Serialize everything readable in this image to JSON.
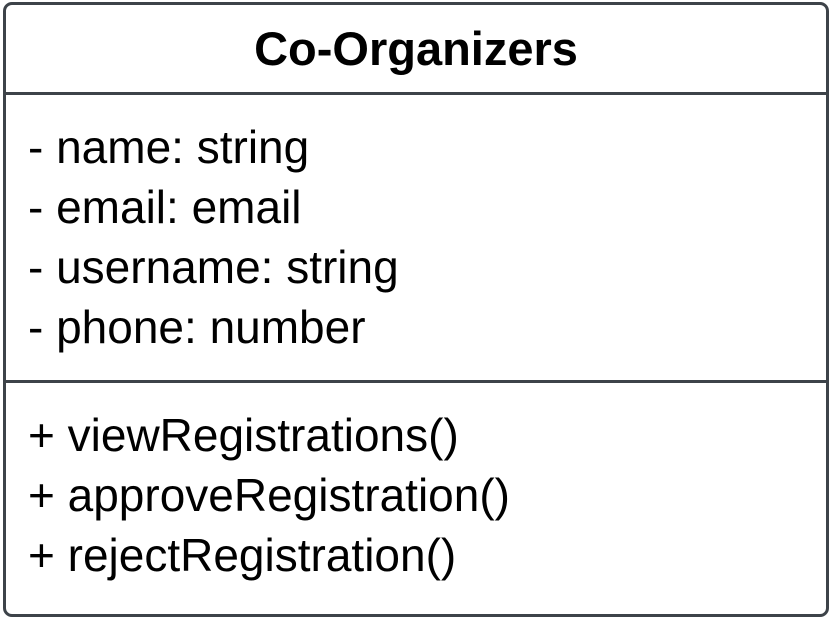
{
  "class": {
    "name": "Co-Organizers",
    "attributes": [
      "- name: string",
      "- email: email",
      "- username: string",
      "- phone: number"
    ],
    "methods": [
      "+ viewRegistrations()",
      "+ approveRegistration()",
      "+ rejectRegistration()"
    ]
  },
  "colors": {
    "border": "#3d4349",
    "text": "#000000",
    "background": "#ffffff"
  }
}
